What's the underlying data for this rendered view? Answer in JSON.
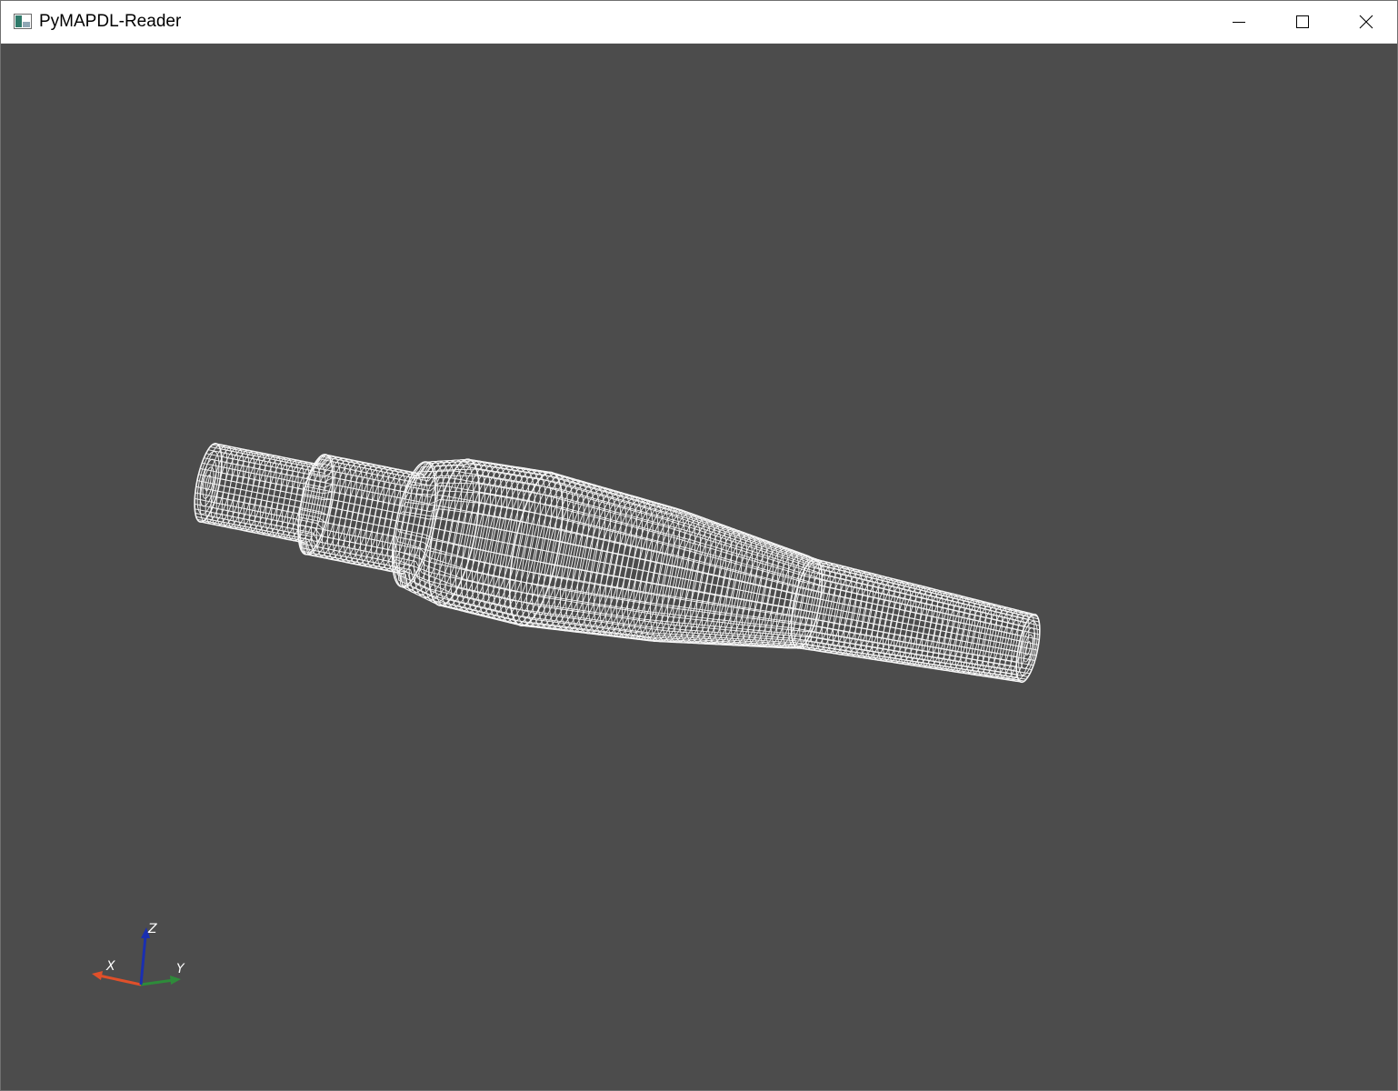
{
  "window": {
    "title": "PyMAPDL-Reader",
    "controls": {
      "minimize_icon": "minimize-icon",
      "maximize_icon": "maximize-icon",
      "close_icon": "close-icon"
    }
  },
  "viewport": {
    "background_color": "#4c4c4c",
    "mesh_color": "#ffffff",
    "render_style": "wireframe"
  },
  "axes": {
    "x_label": "X",
    "y_label": "Y",
    "z_label": "Z",
    "x_color": "#e0502a",
    "y_color": "#2e8b3a",
    "z_color": "#1a2fb0"
  }
}
